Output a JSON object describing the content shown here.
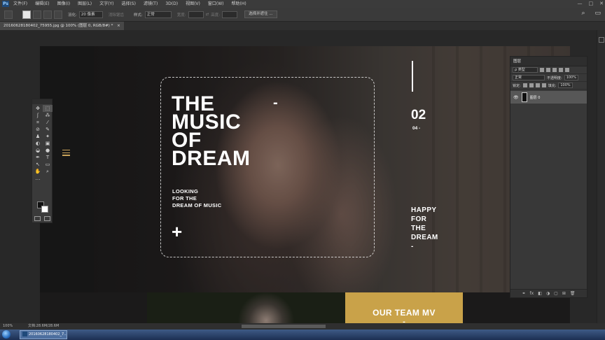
{
  "menubar": {
    "app_icon": "Ps",
    "items": [
      "文件(F)",
      "编辑(E)",
      "图像(I)",
      "图层(L)",
      "文字(Y)",
      "选择(S)",
      "滤镜(T)",
      "3D(D)",
      "视图(V)",
      "窗口(W)",
      "帮助(H)"
    ],
    "window_controls": [
      "—",
      "□",
      "✕"
    ]
  },
  "options": {
    "feather_label": "羽化:",
    "feather_value": "20 像素",
    "antialias_label": "消除锯齿",
    "style_label": "样式:",
    "style_value": "正常",
    "width_label": "宽度:",
    "height_label": "高度:",
    "select_mask_button": "选择并遮住 ...",
    "search_icon": "⌕",
    "workspace_icon": "▭"
  },
  "document": {
    "tab_title": "20160628180402_75955.jpg @ 100% (图层 0, RGB/8#) *",
    "tab_close": "×"
  },
  "design": {
    "title_lines": [
      "THE",
      "MUSIC",
      "OF",
      "DREAM"
    ],
    "title_dash": "-",
    "subtitle_lines": [
      "LOOKING",
      "FOR THE",
      "DREAM OF MUSIC"
    ],
    "plus": "+",
    "number_big": "02",
    "number_small": "04 -",
    "right_lines": [
      "HAPPY",
      "FOR",
      "THE",
      "DREAM",
      "-"
    ],
    "team_label": "OUR TEAM MV",
    "team_dash": "-",
    "accent_color": "#c9a249"
  },
  "tools": {
    "icons": [
      "✥",
      "⬚",
      "ʃ",
      "⁂",
      "⌗",
      "⁄",
      "⊘",
      "✎",
      "♟",
      "✦",
      "◐",
      "▣",
      "◒",
      "●",
      "✒",
      "T",
      "↖",
      "▭",
      "✋",
      "⌕",
      "…",
      ""
    ]
  },
  "layers": {
    "title": "图层",
    "kind_label": "ρ 类型",
    "blend_mode": "正常",
    "opacity_label": "不透明度:",
    "opacity_value": "100%",
    "lock_label": "锁定:",
    "fill_label": "填充:",
    "fill_value": "100%",
    "layer_name": "图层 0",
    "eye": "👁",
    "footer_icons": [
      "⚭",
      "fx",
      "◧",
      "◑",
      "▢",
      "⊞",
      "🗑"
    ]
  },
  "status": {
    "zoom": "100%",
    "doc_info": "文档:28.6M/28.6M"
  },
  "taskbar": {
    "item_label": "20160628180402_7..."
  }
}
